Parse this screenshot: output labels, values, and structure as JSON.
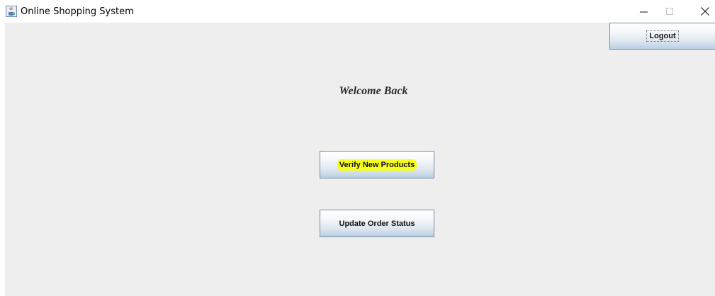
{
  "window": {
    "title": "Online Shopping System",
    "icons": {
      "app": "java-coffee-cup-icon",
      "minimize": "minimize-icon",
      "maximize": "maximize-icon",
      "close": "close-icon"
    }
  },
  "header": {
    "logout_label": "Logout"
  },
  "main": {
    "welcome_text": "Welcome Back",
    "verify_label": "Verify New Products",
    "update_label": "Update Order Status"
  },
  "colors": {
    "content_background": "#eeeeee",
    "highlight": "#f6ff1f",
    "button_border": "#7a8a99"
  }
}
